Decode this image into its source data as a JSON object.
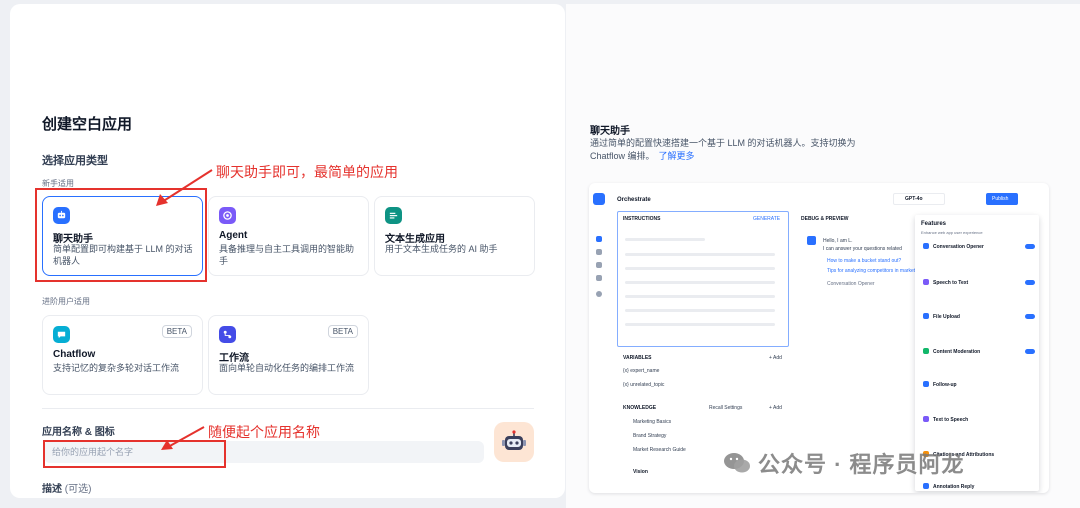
{
  "form": {
    "title": "创建空白应用",
    "type_section": "选择应用类型",
    "beginner_label": "新手适用",
    "advanced_label": "进阶用户适用",
    "types": [
      {
        "name": "聊天助手",
        "desc": "简单配置即可构建基于 LLM 的对话机器人",
        "icon": "robot-chat-icon",
        "color": "#2970ff"
      },
      {
        "name": "Agent",
        "desc": "具备推理与自主工具调用的智能助手",
        "icon": "agent-icon",
        "color": "#7a5af8"
      },
      {
        "name": "文本生成应用",
        "desc": "用于文本生成任务的 AI 助手",
        "icon": "text-generator-icon",
        "color": "#0e9384"
      },
      {
        "name": "Chatflow",
        "desc": "支持记忆的复杂多轮对话工作流",
        "icon": "chatflow-icon",
        "color": "#06aed4",
        "badge": "BETA"
      },
      {
        "name": "工作流",
        "desc": "面向单轮自动化任务的编排工作流",
        "icon": "workflow-icon",
        "color": "#444ce7",
        "badge": "BETA"
      }
    ],
    "name_label": "应用名称 & 图标",
    "name_placeholder": "给你的应用起个名字",
    "desc_label": "描述",
    "desc_optional": "(可选)"
  },
  "annotations": {
    "type_note": "聊天助手即可，最简单的应用",
    "name_note": "随便起个应用名称",
    "color": "#e5322d"
  },
  "preview_panel": {
    "title": "聊天助手",
    "desc": "通过简单的配置快速搭建一个基于 LLM 的对话机器人。支持切换为 Chatflow 编排。",
    "link": "了解更多"
  },
  "preview": {
    "orchestrate": "Orchestrate",
    "model": "GPT-4o",
    "publish": "Publish",
    "instructions": "INSTRUCTIONS",
    "generate": "GENERATE",
    "debug": "DEBUG & PREVIEW",
    "greeting": "Hello, I am L.",
    "greeting2": "I can answer your questions related",
    "q1": "How to make a bucket stand out?",
    "q2": "Tips for analyzing competitors in market",
    "opener": "Conversation Opener",
    "edit": "Edit",
    "variables": "VARIABLES",
    "add": "+ Add",
    "var1": "{x} expert_name",
    "var2": "{x} unrelated_topic",
    "knowledge": "KNOWLEDGE",
    "recall": "Recall Settings",
    "kb": [
      "Marketing Basics",
      "Brand Strategy",
      "Market Research Guide"
    ],
    "vision": "Vision",
    "features_title": "Features",
    "features_sub": "Enhance web app user experience",
    "features": [
      "Conversation Opener",
      "Speech to Text",
      "File Upload",
      "Content Moderation",
      "Follow-up",
      "Text to Speech",
      "Citations and Attributions",
      "Annotation Reply"
    ]
  },
  "watermark": {
    "text": "公众号 · 程序员阿龙"
  }
}
